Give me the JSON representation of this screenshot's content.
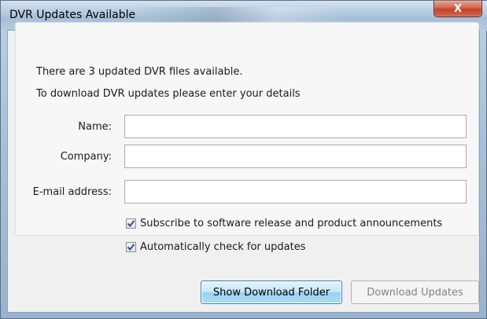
{
  "window": {
    "title": "DVR Updates Available",
    "close_glyph": "X"
  },
  "message": {
    "line1": "There are 3 updated DVR files available.",
    "line2": "To download DVR updates please enter your details"
  },
  "form": {
    "name_label": "Name:",
    "name_value": "",
    "company_label": "Company:",
    "company_value": "",
    "email_label": "E-mail address:",
    "email_value": ""
  },
  "options": {
    "subscribe_label": "Subscribe to software release and product announcements",
    "subscribe_checked": true,
    "autocheck_label": "Automatically check for updates",
    "autocheck_checked": true
  },
  "buttons": {
    "show_folder": "Show Download Folder",
    "download": "Download Updates"
  },
  "colors": {
    "check": "#2e4f8a",
    "close_button": "#c8432c",
    "primary_button_border": "#3c7fb1",
    "disabled_text": "#838383"
  }
}
